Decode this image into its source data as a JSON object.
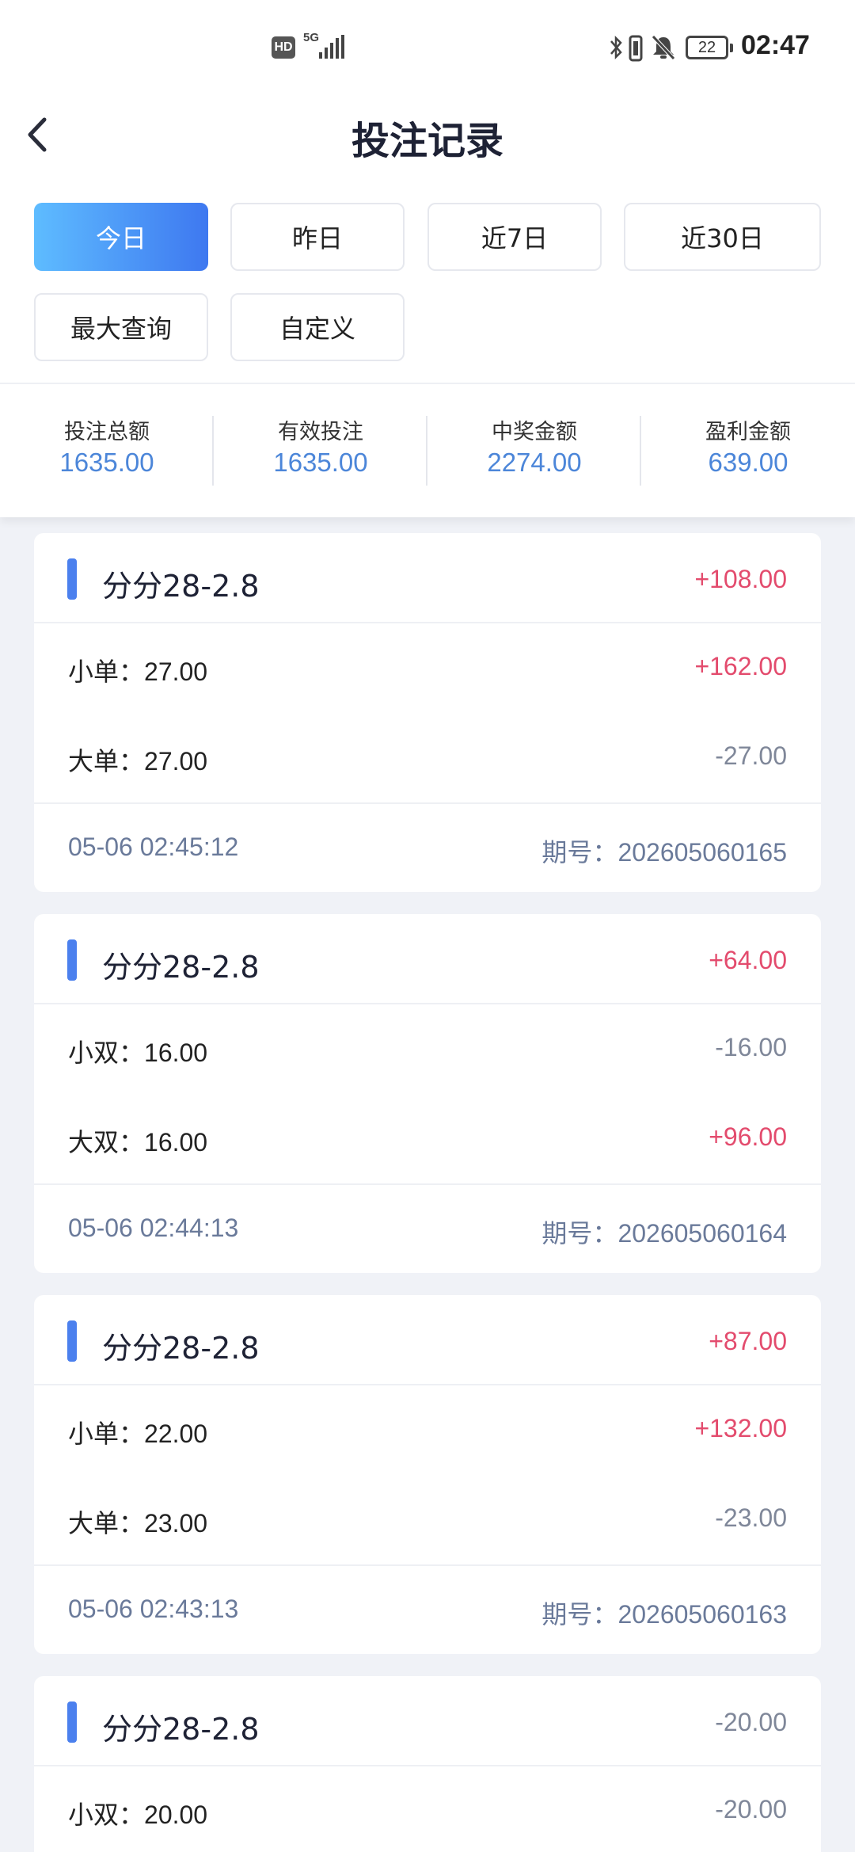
{
  "status_bar": {
    "hd_label": "HD",
    "network_label": "5G",
    "battery_level": "22",
    "time": "02:47"
  },
  "header": {
    "title": "投注记录"
  },
  "filters": [
    {
      "label": "今日",
      "active": true
    },
    {
      "label": "昨日",
      "active": false
    },
    {
      "label": "近7日",
      "active": false
    },
    {
      "label": "近30日",
      "active": false
    },
    {
      "label": "最大查询",
      "active": false
    },
    {
      "label": "自定义",
      "active": false
    }
  ],
  "summary": [
    {
      "label": "投注总额",
      "value": "1635.00"
    },
    {
      "label": "有效投注",
      "value": "1635.00"
    },
    {
      "label": "中奖金额",
      "value": "2274.00"
    },
    {
      "label": "盈利金额",
      "value": "639.00"
    }
  ],
  "records": [
    {
      "name": "分分28-2.8",
      "total": "+108.00",
      "bets": [
        {
          "label": "小单：",
          "amount": "27.00",
          "result": "+162.00"
        },
        {
          "label": "大单：",
          "amount": "27.00",
          "result": "-27.00"
        }
      ],
      "time": "05-06 02:45:12",
      "issue_label": "期号：",
      "issue": "202605060165"
    },
    {
      "name": "分分28-2.8",
      "total": "+64.00",
      "bets": [
        {
          "label": "小双：",
          "amount": "16.00",
          "result": "-16.00"
        },
        {
          "label": "大双：",
          "amount": "16.00",
          "result": "+96.00"
        }
      ],
      "time": "05-06 02:44:13",
      "issue_label": "期号：",
      "issue": "202605060164"
    },
    {
      "name": "分分28-2.8",
      "total": "+87.00",
      "bets": [
        {
          "label": "小单：",
          "amount": "22.00",
          "result": "+132.00"
        },
        {
          "label": "大单：",
          "amount": "23.00",
          "result": "-23.00"
        }
      ],
      "time": "05-06 02:43:13",
      "issue_label": "期号：",
      "issue": "202605060163"
    },
    {
      "name": "分分28-2.8",
      "total": "-20.00",
      "bets": [
        {
          "label": "小双：",
          "amount": "20.00",
          "result": "-20.00"
        }
      ]
    }
  ],
  "colors": {
    "accent": "#3e78f0",
    "accent_light": "#5ebcff",
    "summary_value": "#4c86d9",
    "positive": "#e34b6d",
    "negative": "#7f8799",
    "footer_text": "#6a7a9a",
    "background": "#f0f2f7"
  }
}
